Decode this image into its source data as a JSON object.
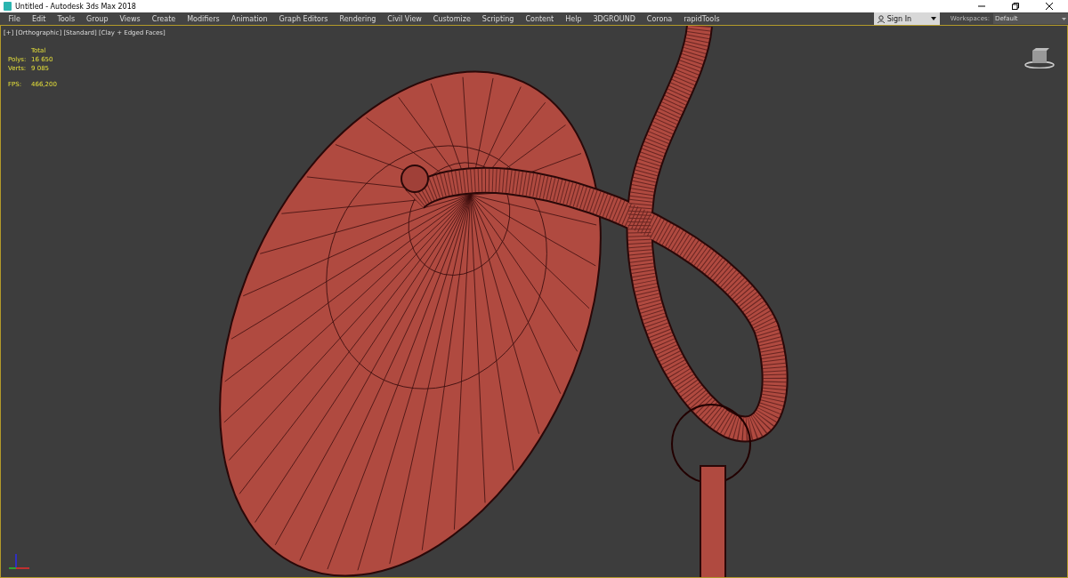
{
  "window": {
    "title": "Untitled - Autodesk 3ds Max 2018"
  },
  "menu": [
    "File",
    "Edit",
    "Tools",
    "Group",
    "Views",
    "Create",
    "Modifiers",
    "Animation",
    "Graph Editors",
    "Rendering",
    "Civil View",
    "Customize",
    "Scripting",
    "Content",
    "Help",
    "3DGROUND",
    "Corona",
    "rapidTools"
  ],
  "sign_in": {
    "label": "Sign In"
  },
  "workspaces": {
    "label": "Workspaces:",
    "value": "Default"
  },
  "viewport": {
    "label": "[+] [Orthographic] [Standard] [Clay + Edged Faces]",
    "stats": {
      "header": "Total",
      "rows": [
        {
          "label": "Polys:",
          "value": "16 650"
        },
        {
          "label": "Verts:",
          "value": "9 085"
        },
        {
          "label": "FPS:",
          "value": "466,200"
        }
      ]
    }
  }
}
